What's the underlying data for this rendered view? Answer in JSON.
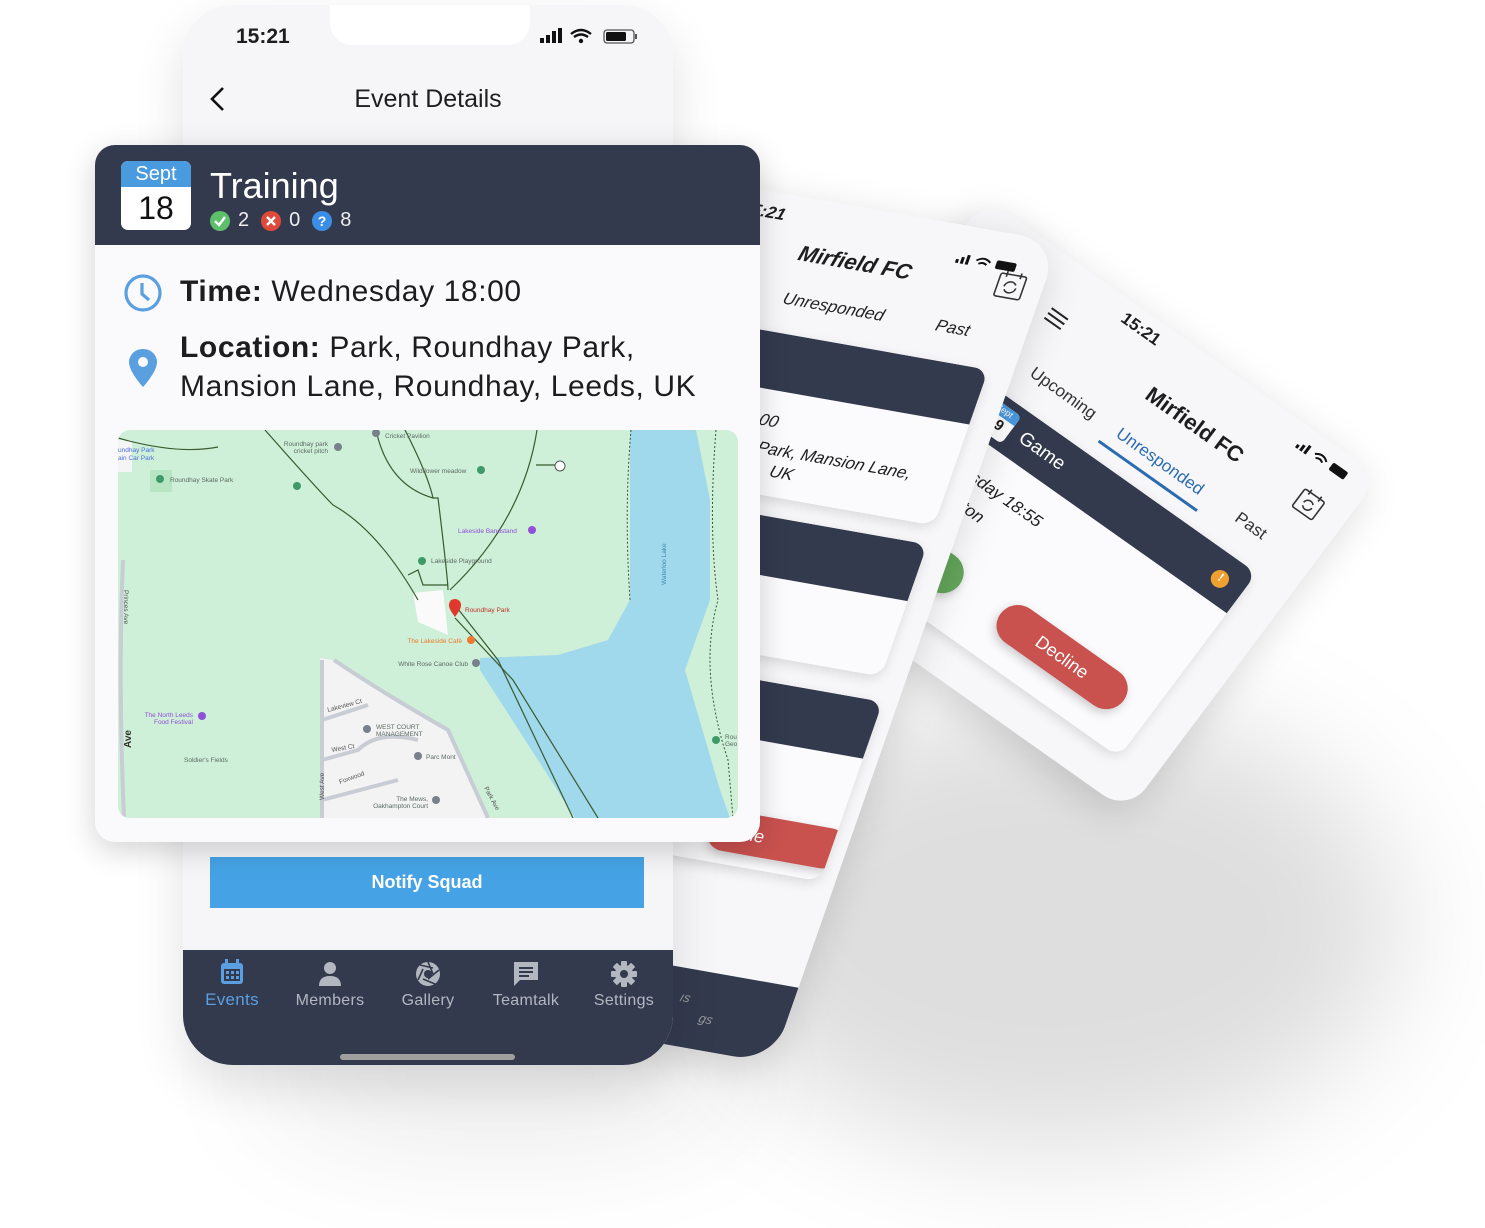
{
  "main_phone": {
    "status_time": "15:21",
    "header_title": "Event Details",
    "event": {
      "month": "Sept",
      "day": "18",
      "title": "Training",
      "accepted_count": "2",
      "declined_count": "0",
      "unresponded_count": "8",
      "time_label": "Time:",
      "time_value": "Wednesday 18:00",
      "location_label": "Location:",
      "location_line1": "Park, Roundhay Park,",
      "location_line2": "Mansion Lane, Roundhay, Leeds, UK"
    },
    "map_labels": {
      "car_park_1": "undhay Park",
      "car_park_2": "ain Car Park",
      "skate_park": "Roundhay Skate Park",
      "cricket_pitch_1": "Roundhay park",
      "cricket_pitch_2": "cricket pitch",
      "cricket_pavilion": "Cricket Pavilion",
      "wildflower": "Wildflower meadow",
      "bandstand": "Lakeside Bandstand",
      "playground": "Lakeside Playground",
      "roundhay_park": "Roundhay Park",
      "cafe": "The Lakeside Café",
      "canoe_club": "White Rose Canoe Club",
      "waterloo_lake": "Waterloo Lake",
      "princes_ave": "Princes Ave",
      "ave": "Ave",
      "food_festival_1": "The North Leeds",
      "food_festival_2": "Food Festival",
      "soldiers_fields": "Soldier's Fields",
      "lakeview_ct": "Lakeview Ct",
      "west_court_1": "WEST COURT",
      "west_court_2": "MANAGEMENT",
      "west_ct": "West Ct",
      "parc_mont": "Parc Mont",
      "foxwood": "Foxwood",
      "mews_1": "The Mews,",
      "mews_2": "Oakhampton Court",
      "west_ave": "West Ave",
      "park_ave": "Park Ave",
      "rou_1": "Rou",
      "rou_2": "Geo"
    },
    "notify_button": "Notify Squad",
    "nav": [
      {
        "label": "Events",
        "icon": "calendar-icon",
        "active": true
      },
      {
        "label": "Members",
        "icon": "person-icon"
      },
      {
        "label": "Gallery",
        "icon": "aperture-icon"
      },
      {
        "label": "Teamtalk",
        "icon": "chat-icon"
      },
      {
        "label": "Settings",
        "icon": "gear-icon"
      }
    ]
  },
  "middle_phone": {
    "status_time": "5:21",
    "title": "Mirfield FC",
    "tabs": [
      "Unresponded",
      "Past"
    ],
    "card_time_fragment": ":00",
    "card_location_fragment_1": "Park, Mansion Lane,",
    "card_location_fragment_2": "UK",
    "decline_fragment": "cline",
    "nav_fragment_1": "ıs",
    "nav_fragment_2": "gs"
  },
  "back_phone": {
    "status_time": "15:21",
    "title": "Mirfield FC",
    "tabs": [
      "Upcoming",
      "Unresponded",
      "Past"
    ],
    "event": {
      "month": "Sept",
      "day": "19",
      "title": "Game",
      "time_fragment": "hursday 18:55",
      "location_fragment": "ckheaton",
      "accept_fragment": "t",
      "decline": "Decline"
    }
  },
  "colors": {
    "navy": "#343a4e",
    "accent_blue": "#45a3e5",
    "accept_green": "#63a55a",
    "decline_red": "#c9514e",
    "warning_orange": "#f0a030",
    "map_green": "#ceefd8",
    "water_blue": "#a0d8ec"
  }
}
